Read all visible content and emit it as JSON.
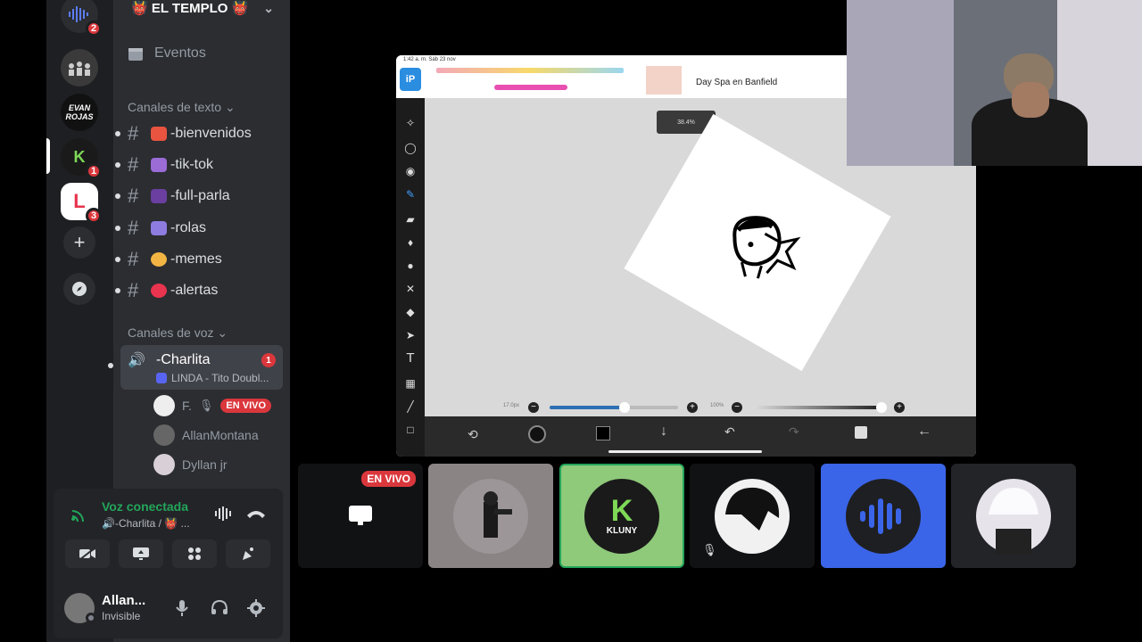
{
  "server": {
    "name": "👹 EL TEMPLO 👹",
    "badges": [
      "2",
      "1",
      "3"
    ]
  },
  "sidebar": {
    "events_label": "Eventos",
    "text_category": "Canales de texto",
    "text_channels": [
      {
        "name": "-bienvenidos",
        "emoji_color": "#e8543f"
      },
      {
        "name": "-tik-tok",
        "emoji_color": "#9b6bd6"
      },
      {
        "name": "-full-parla",
        "emoji_color": "#6b3fa0"
      },
      {
        "name": "-rolas",
        "emoji_color": "#8e7ce0"
      },
      {
        "name": "-memes",
        "emoji_color": "#f2b544"
      },
      {
        "name": "-alertas",
        "emoji_color": "#e8344e"
      }
    ],
    "voice_category": "Canales de voz",
    "voice_channel": {
      "name": "-Charlita",
      "badge": "1",
      "activity": "LINDA - Tito Doubl..."
    },
    "voice_users": [
      {
        "name": "F.",
        "live": "EN VIVO"
      },
      {
        "name": "AllanMontana"
      },
      {
        "name": "Dyllan jr"
      }
    ]
  },
  "voice_panel": {
    "status": "Voz conectada",
    "channel": "🔊-Charlita / 👹 ...",
    "user_name": "Allan...",
    "user_status": "Invisible"
  },
  "screenshare": {
    "time": "1:42 a. m.   Sáb 23 nov",
    "ad_title": "Day Spa en Banfield",
    "zoom": "38.4%",
    "brush_size": "17.0px",
    "opacity": "100%"
  },
  "stage": {
    "live_label": "EN VIVO"
  },
  "colors": {
    "accent_green": "#23a55a",
    "live_red": "#da373c",
    "blurple": "#3b65e8"
  }
}
